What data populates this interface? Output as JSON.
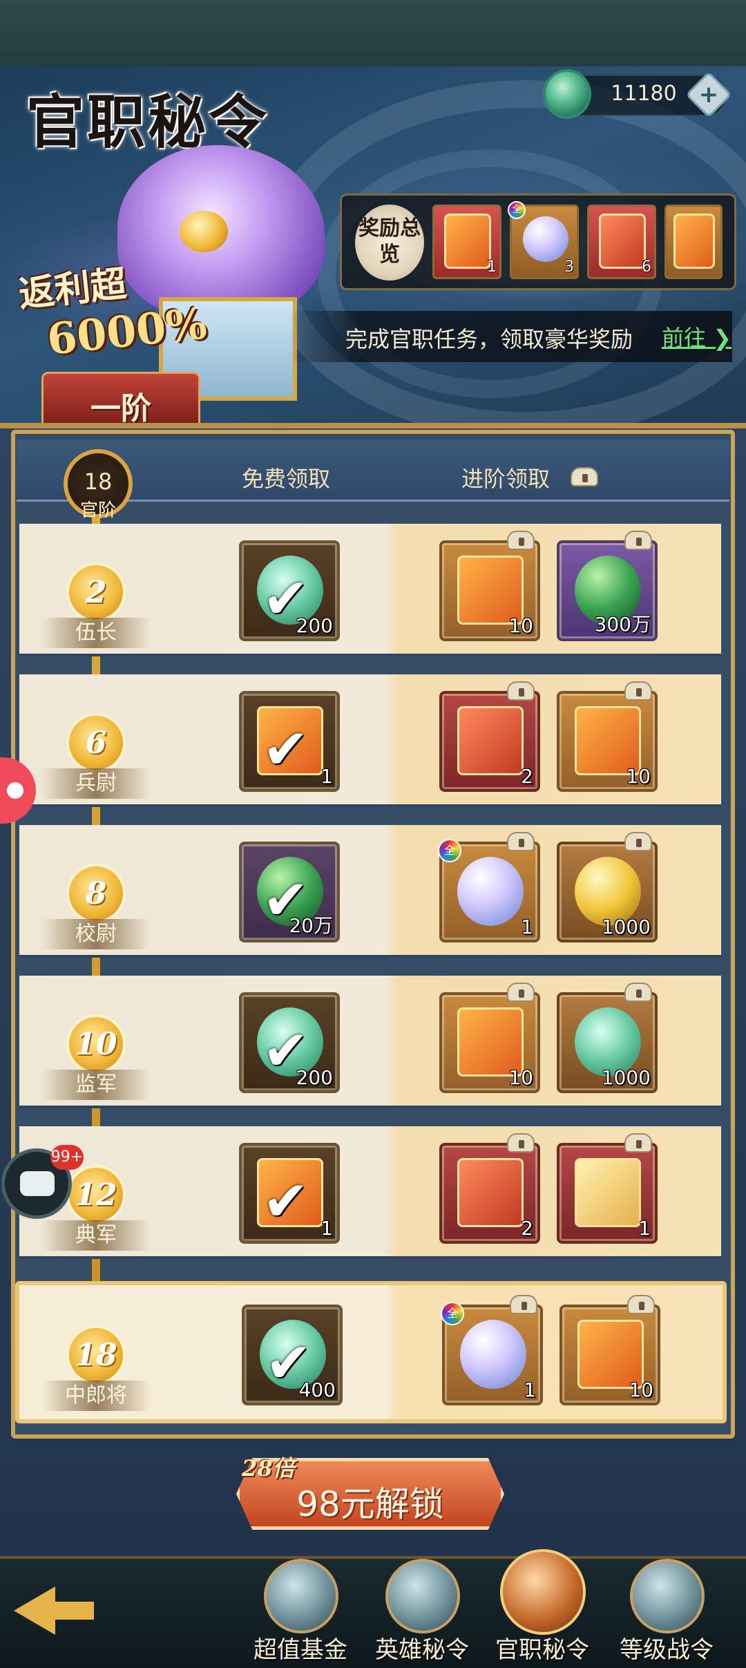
{
  "banner": {
    "title": "官职秘令",
    "jade_value": "11180",
    "plus_label": "+",
    "rebate_line1": "返利超",
    "rebate_line2": "6000%",
    "reward_overview_label": "奖励总览",
    "reward_overview_items": [
      {
        "type": "card",
        "count": "1"
      },
      {
        "type": "orb",
        "count": "3"
      },
      {
        "type": "card-red",
        "count": "6"
      },
      {
        "type": "card",
        "count": ""
      }
    ],
    "task_text": "完成官职任务，领取豪华奖励",
    "task_go": "前往",
    "tier_tab": "一阶"
  },
  "header": {
    "current_rank": "18",
    "rank_caption": "官阶",
    "free_label": "免费领取",
    "advanced_label": "进阶领取"
  },
  "rows": [
    {
      "level": "2",
      "name": "伍长",
      "free": {
        "icon": "jade",
        "count": "200",
        "claimed": true
      },
      "adv": [
        {
          "icon": "card",
          "count": "10"
        },
        {
          "icon": "green-orb",
          "count": "300万"
        }
      ]
    },
    {
      "level": "6",
      "name": "兵尉",
      "free": {
        "icon": "card",
        "count": "1",
        "claimed": true
      },
      "adv": [
        {
          "icon": "card-red",
          "count": "2"
        },
        {
          "icon": "card",
          "count": "10"
        }
      ]
    },
    {
      "level": "8",
      "name": "校尉",
      "free": {
        "icon": "green-orb",
        "count": "20万",
        "claimed": true
      },
      "adv": [
        {
          "icon": "orb",
          "count": "1"
        },
        {
          "icon": "gold",
          "count": "1000"
        }
      ]
    },
    {
      "level": "10",
      "name": "监军",
      "free": {
        "icon": "jade",
        "count": "200",
        "claimed": true
      },
      "adv": [
        {
          "icon": "card",
          "count": "10"
        },
        {
          "icon": "jade",
          "count": "1000"
        }
      ]
    },
    {
      "level": "12",
      "name": "典军",
      "free": {
        "icon": "card",
        "count": "1",
        "claimed": true
      },
      "adv": [
        {
          "icon": "card-red",
          "count": "2"
        },
        {
          "icon": "card-red",
          "count": "1"
        }
      ]
    },
    {
      "level": "18",
      "name": "中郎将",
      "free": {
        "icon": "jade",
        "count": "400",
        "claimed": true
      },
      "adv": [
        {
          "icon": "orb",
          "count": "1"
        },
        {
          "icon": "card",
          "count": "10"
        }
      ]
    }
  ],
  "unlock": {
    "multiplier": "28倍",
    "label": "98元解锁"
  },
  "chat": {
    "badge": "99+"
  },
  "bottom_nav": [
    {
      "label": "超值基金"
    },
    {
      "label": "英雄秘令"
    },
    {
      "label": "官职秘令",
      "active": true
    },
    {
      "label": "等级战令"
    }
  ]
}
